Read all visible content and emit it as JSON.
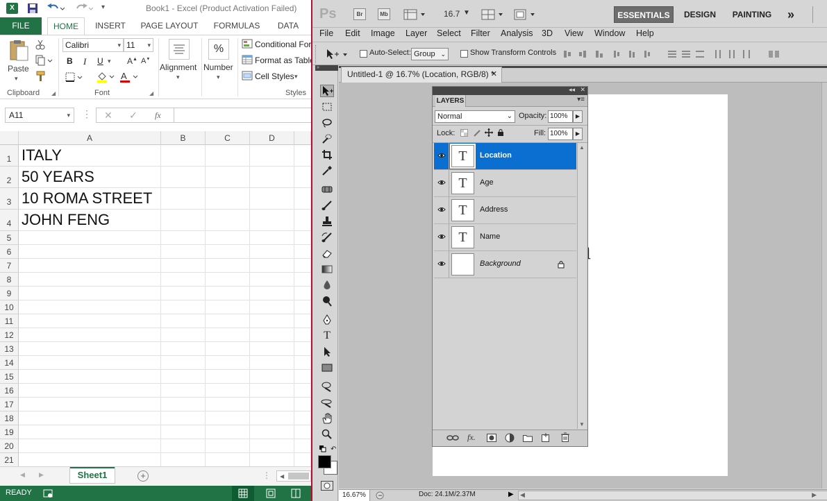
{
  "excel": {
    "title": "Book1 - Excel (Product Activation Failed)",
    "tabs": [
      "FILE",
      "HOME",
      "INSERT",
      "PAGE LAYOUT",
      "FORMULAS",
      "DATA"
    ],
    "active_tab": "HOME",
    "ribbon": {
      "paste": "Paste",
      "font_name": "Calibri",
      "font_size": "11",
      "bold": "B",
      "italic": "I",
      "underline": "U",
      "alignment": "Alignment",
      "number": "Number",
      "percent": "%",
      "conditional": "Conditional For",
      "format_table": "Format as Table",
      "cell_styles": "Cell Styles",
      "groups": {
        "clipboard": "Clipboard",
        "font": "Font",
        "styles": "Styles"
      }
    },
    "name_box": "A11",
    "fx": "fx",
    "columns": [
      "A",
      "B",
      "C",
      "D"
    ],
    "rows": [
      "1",
      "2",
      "3",
      "4",
      "5",
      "6",
      "7",
      "8",
      "9",
      "10",
      "11",
      "12",
      "13",
      "14",
      "15",
      "16",
      "17",
      "18",
      "19",
      "20",
      "21"
    ],
    "cells": [
      "ITALY",
      "50 YEARS",
      "10 ROMA STREET",
      "JOHN FENG"
    ],
    "sheet_tab": "Sheet1",
    "status": "READY",
    "accent": "#217346"
  },
  "photoshop": {
    "logo": "Ps",
    "bridge": "Br",
    "mini_bridge": "Mb",
    "zoom_field": "16.7",
    "workspaces": [
      "ESSENTIALS",
      "DESIGN",
      "PAINTING"
    ],
    "more": "»",
    "menu": [
      "File",
      "Edit",
      "Image",
      "Layer",
      "Select",
      "Filter",
      "Analysis",
      "3D",
      "View",
      "Window",
      "Help"
    ],
    "options": {
      "auto_select": "Auto-Select:",
      "group_value": "Group",
      "transform": "Show Transform Controls"
    },
    "doc_tab": "Untitled-1 @ 16.7% (Location, RGB/8) *",
    "layers_panel": {
      "tab": "LAYERS",
      "blend_mode": "Normal",
      "opacity_label": "Opacity:",
      "opacity_value": "100%",
      "lock_label": "Lock:",
      "fill_label": "Fill:",
      "fill_value": "100%",
      "layers": [
        "Location",
        "Age",
        "Address",
        "Name",
        "Background"
      ],
      "thumb_glyph": "T"
    },
    "canvas_glyph": "n",
    "status_zoom": "16.67%",
    "doc_size": "Doc: 24.1M/2.37M",
    "selection_color": "#0a6fd0"
  }
}
